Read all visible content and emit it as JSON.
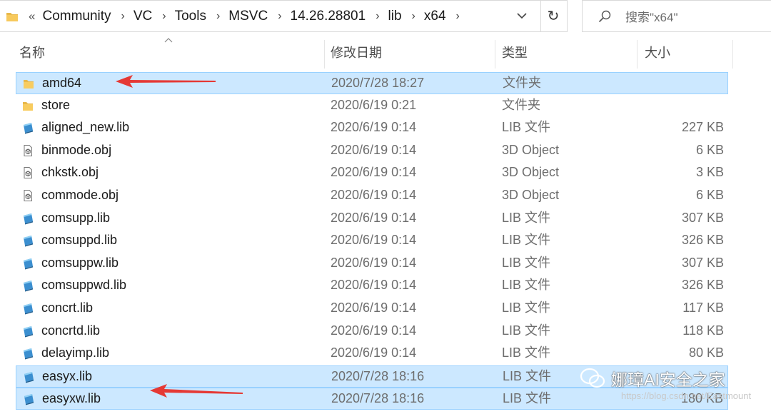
{
  "breadcrumb": {
    "overflow": "«",
    "items": [
      "Community",
      "VC",
      "Tools",
      "MSVC",
      "14.26.28801",
      "lib",
      "x64"
    ],
    "separator": "›"
  },
  "search": {
    "placeholder": "搜索\"x64\""
  },
  "refresh_glyph": "↻",
  "headers": {
    "name": "名称",
    "date": "修改日期",
    "type": "类型",
    "size": "大小"
  },
  "files": [
    {
      "name": "amd64",
      "date": "2020/7/28 18:27",
      "type": "文件夹",
      "size": "",
      "icon": "folder-icon",
      "selected": true
    },
    {
      "name": "store",
      "date": "2020/6/19 0:21",
      "type": "文件夹",
      "size": "",
      "icon": "folder-icon",
      "selected": false
    },
    {
      "name": "aligned_new.lib",
      "date": "2020/6/19 0:14",
      "type": "LIB 文件",
      "size": "227 KB",
      "icon": "lib-file-icon",
      "selected": false
    },
    {
      "name": "binmode.obj",
      "date": "2020/6/19 0:14",
      "type": "3D Object",
      "size": "6 KB",
      "icon": "obj-file-icon",
      "selected": false
    },
    {
      "name": "chkstk.obj",
      "date": "2020/6/19 0:14",
      "type": "3D Object",
      "size": "3 KB",
      "icon": "obj-file-icon",
      "selected": false
    },
    {
      "name": "commode.obj",
      "date": "2020/6/19 0:14",
      "type": "3D Object",
      "size": "6 KB",
      "icon": "obj-file-icon",
      "selected": false
    },
    {
      "name": "comsupp.lib",
      "date": "2020/6/19 0:14",
      "type": "LIB 文件",
      "size": "307 KB",
      "icon": "lib-file-icon",
      "selected": false
    },
    {
      "name": "comsuppd.lib",
      "date": "2020/6/19 0:14",
      "type": "LIB 文件",
      "size": "326 KB",
      "icon": "lib-file-icon",
      "selected": false
    },
    {
      "name": "comsuppw.lib",
      "date": "2020/6/19 0:14",
      "type": "LIB 文件",
      "size": "307 KB",
      "icon": "lib-file-icon",
      "selected": false
    },
    {
      "name": "comsuppwd.lib",
      "date": "2020/6/19 0:14",
      "type": "LIB 文件",
      "size": "326 KB",
      "icon": "lib-file-icon",
      "selected": false
    },
    {
      "name": "concrt.lib",
      "date": "2020/6/19 0:14",
      "type": "LIB 文件",
      "size": "117 KB",
      "icon": "lib-file-icon",
      "selected": false
    },
    {
      "name": "concrtd.lib",
      "date": "2020/6/19 0:14",
      "type": "LIB 文件",
      "size": "118 KB",
      "icon": "lib-file-icon",
      "selected": false
    },
    {
      "name": "delayimp.lib",
      "date": "2020/6/19 0:14",
      "type": "LIB 文件",
      "size": "80 KB",
      "icon": "lib-file-icon",
      "selected": false
    },
    {
      "name": "easyx.lib",
      "date": "2020/7/28 18:16",
      "type": "LIB 文件",
      "size": "",
      "icon": "lib-file-icon",
      "selected": true
    },
    {
      "name": "easyxw.lib",
      "date": "2020/7/28 18:16",
      "type": "LIB 文件",
      "size": "180 KB",
      "icon": "lib-file-icon",
      "selected": true
    }
  ],
  "watermark": {
    "title": "娜璋AI安全之家",
    "sub": "https://blog.csdn.net/Eastmount"
  },
  "colors": {
    "selection": "#cce8ff",
    "selection_border": "#99d1ff",
    "arrow": "#e53935"
  }
}
